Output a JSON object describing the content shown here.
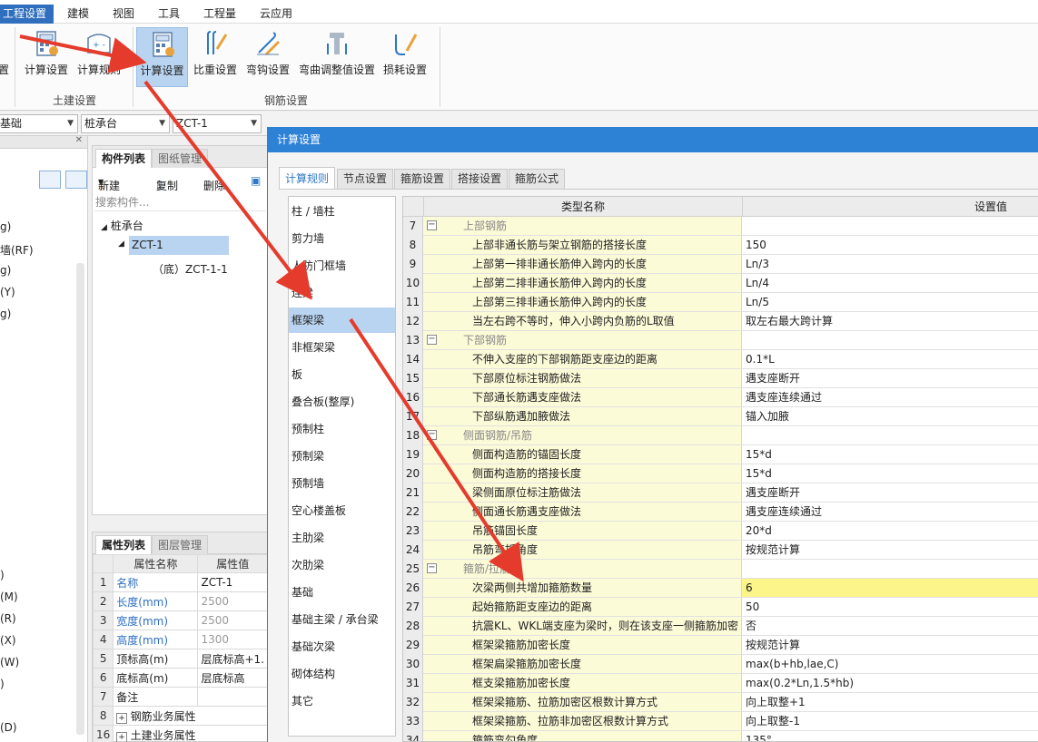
{
  "menu": {
    "items": [
      "工程设置",
      "建模",
      "视图",
      "工具",
      "工程量",
      "云应用"
    ]
  },
  "ribbon": {
    "left_cut_label": "置",
    "buttons": [
      {
        "label": "计算设置"
      },
      {
        "label": "计算规则"
      },
      {
        "label": "计算设置"
      },
      {
        "label": "比重设置"
      },
      {
        "label": "弯钩设置"
      },
      {
        "label": "弯曲调整值设置"
      },
      {
        "label": "损耗设置"
      }
    ],
    "groups": {
      "civil": "土建设置",
      "rebar": "钢筋设置"
    }
  },
  "combos": [
    {
      "value": "基础"
    },
    {
      "value": "桩承台"
    },
    {
      "value": "ZCT-1"
    }
  ],
  "left_panel": {
    "items": [
      "g)",
      "墙(RF)",
      "g)",
      "(Y)",
      "g)",
      ")",
      "(M)",
      "(R)",
      "(X)",
      "(W)",
      ")",
      "(D)"
    ]
  },
  "component_list": {
    "tab_active": "构件列表",
    "tab_other": "图纸管理",
    "new_label": "新建",
    "copy_label": "复制",
    "delete_label": "删除",
    "search_placeholder": "搜索构件...",
    "tree_root": "桩承台",
    "tree_child": "ZCT-1",
    "tree_leaf": "（底）ZCT-1-1"
  },
  "property_list": {
    "tab_active": "属性列表",
    "tab_other": "图层管理",
    "col_name": "属性名称",
    "col_value": "属性值",
    "rows": [
      {
        "num": "1",
        "name": "名称",
        "value": "ZCT-1"
      },
      {
        "num": "2",
        "name": "长度(mm)",
        "value": "2500"
      },
      {
        "num": "3",
        "name": "宽度(mm)",
        "value": "2500"
      },
      {
        "num": "4",
        "name": "高度(mm)",
        "value": "1300"
      },
      {
        "num": "5",
        "name": "顶标高(m)",
        "value": "层底标高+1."
      },
      {
        "num": "6",
        "name": "底标高(m)",
        "value": "层底标高"
      },
      {
        "num": "7",
        "name": "备注",
        "value": ""
      },
      {
        "num": "8",
        "name": "钢筋业务属性",
        "value": ""
      },
      {
        "num": "16",
        "name": "土建业务属性",
        "value": ""
      }
    ]
  },
  "dialog": {
    "title": "计算设置",
    "tabs": [
      "计算规则",
      "节点设置",
      "箍筋设置",
      "搭接设置",
      "箍筋公式"
    ],
    "categories": [
      "柱 / 墙柱",
      "剪力墙",
      "人防门框墙",
      "连梁",
      "框架梁",
      "非框架梁",
      "板",
      "叠合板(整厚)",
      "预制柱",
      "预制梁",
      "预制墙",
      "空心楼盖板",
      "主肋梁",
      "次肋梁",
      "基础",
      "基础主梁 / 承台梁",
      "基础次梁",
      "砌体结构",
      "其它"
    ],
    "grid_header": {
      "name": "类型名称",
      "value": "设置值"
    },
    "rows": [
      {
        "num": "7",
        "name": "上部钢筋",
        "value": "",
        "group": true
      },
      {
        "num": "8",
        "name": "上部非通长筋与架立钢筋的搭接长度",
        "value": "150"
      },
      {
        "num": "9",
        "name": "上部第一排非通长筋伸入跨内的长度",
        "value": "Ln/3"
      },
      {
        "num": "10",
        "name": "上部第二排非通长筋伸入跨内的长度",
        "value": "Ln/4"
      },
      {
        "num": "11",
        "name": "上部第三排非通长筋伸入跨内的长度",
        "value": "Ln/5"
      },
      {
        "num": "12",
        "name": "当左右跨不等时，伸入小跨内负筋的L取值",
        "value": "取左右最大跨计算"
      },
      {
        "num": "13",
        "name": "下部钢筋",
        "value": "",
        "group": true
      },
      {
        "num": "14",
        "name": "不伸入支座的下部钢筋距支座边的距离",
        "value": "0.1*L"
      },
      {
        "num": "15",
        "name": "下部原位标注钢筋做法",
        "value": "遇支座断开"
      },
      {
        "num": "16",
        "name": "下部通长筋遇支座做法",
        "value": "遇支座连续通过"
      },
      {
        "num": "17",
        "name": "下部纵筋遇加腋做法",
        "value": "锚入加腋"
      },
      {
        "num": "18",
        "name": "侧面钢筋/吊筋",
        "value": "",
        "group": true
      },
      {
        "num": "19",
        "name": "侧面构造筋的锚固长度",
        "value": "15*d"
      },
      {
        "num": "20",
        "name": "侧面构造筋的搭接长度",
        "value": "15*d"
      },
      {
        "num": "21",
        "name": "梁侧面原位标注筋做法",
        "value": "遇支座断开"
      },
      {
        "num": "22",
        "name": "侧面通长筋遇支座做法",
        "value": "遇支座连续通过"
      },
      {
        "num": "23",
        "name": "吊筋锚固长度",
        "value": "20*d"
      },
      {
        "num": "24",
        "name": "吊筋弯折角度",
        "value": "按规范计算"
      },
      {
        "num": "25",
        "name": "箍筋/拉筋",
        "value": "",
        "group": true
      },
      {
        "num": "26",
        "name": "次梁两侧共增加箍筋数量",
        "value": "6",
        "highlight": true
      },
      {
        "num": "27",
        "name": "起始箍筋距支座边的距离",
        "value": "50"
      },
      {
        "num": "28",
        "name": "抗震KL、WKL端支座为梁时，则在该支座一侧箍筋加密",
        "value": "否"
      },
      {
        "num": "29",
        "name": "框架梁箍筋加密长度",
        "value": "按规范计算"
      },
      {
        "num": "30",
        "name": "框架扁梁箍筋加密长度",
        "value": "max(b+hb,lae,C)"
      },
      {
        "num": "31",
        "name": "框支梁箍筋加密长度",
        "value": "max(0.2*Ln,1.5*hb)"
      },
      {
        "num": "32",
        "name": "框架梁箍筋、拉筋加密区根数计算方式",
        "value": "向上取整+1"
      },
      {
        "num": "33",
        "name": "框架梁箍筋、拉筋非加密区根数计算方式",
        "value": "向上取整-1"
      },
      {
        "num": "34",
        "name": "箍筋弯勾角度",
        "value": "135°"
      }
    ]
  },
  "colors": {
    "accent": "#2e82d6",
    "annotation_arrow": "#e53b2c",
    "row_name_bg": "#fcfbd8",
    "highlight_value_bg": "#fbf58a",
    "selected_bg": "#b9d4f0"
  }
}
